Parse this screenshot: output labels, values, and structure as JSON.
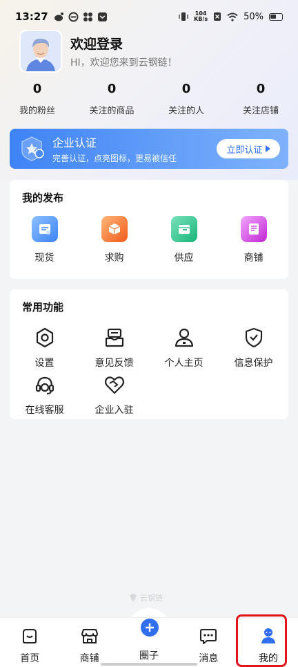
{
  "status_bar": {
    "time": "13:27",
    "net_speed_top": "104",
    "net_speed_bottom": "KB/s",
    "battery": "50%"
  },
  "profile": {
    "title": "欢迎登录",
    "subtitle": "HI，欢迎您来到云钢链！"
  },
  "stats": [
    {
      "value": "0",
      "label": "我的粉丝"
    },
    {
      "value": "0",
      "label": "关注的商品"
    },
    {
      "value": "0",
      "label": "关注的人"
    },
    {
      "value": "0",
      "label": "关注店铺"
    }
  ],
  "certification": {
    "title": "企业认证",
    "subtitle": "完善认证，点亮图标，更易被信任",
    "button": "立即认证"
  },
  "my_publish": {
    "title": "我的发布",
    "items": [
      {
        "label": "现货",
        "icon": "document-icon",
        "color": "#3b82f6"
      },
      {
        "label": "求购",
        "icon": "box-icon",
        "color": "#f97316"
      },
      {
        "label": "供应",
        "icon": "storage-box-icon",
        "color": "#22c08a"
      },
      {
        "label": "商铺",
        "icon": "shop-doc-icon",
        "color": "#d946ef"
      }
    ]
  },
  "common_functions": {
    "title": "常用功能",
    "items": [
      {
        "label": "设置",
        "icon": "settings-icon"
      },
      {
        "label": "意见反馈",
        "icon": "feedback-icon"
      },
      {
        "label": "个人主页",
        "icon": "person-icon"
      },
      {
        "label": "信息保护",
        "icon": "shield-icon"
      },
      {
        "label": "在线客服",
        "icon": "headset-icon"
      },
      {
        "label": "企业入驻",
        "icon": "handshake-heart-icon"
      }
    ]
  },
  "watermark": "云钢链",
  "tabbar": {
    "items": [
      {
        "label": "首页",
        "icon": "home-icon"
      },
      {
        "label": "商铺",
        "icon": "store-icon"
      },
      {
        "label": "圈子",
        "icon": "plus-circle-icon"
      },
      {
        "label": "消息",
        "icon": "message-icon"
      },
      {
        "label": "我的",
        "icon": "profile-icon"
      }
    ],
    "active_index": 4
  }
}
